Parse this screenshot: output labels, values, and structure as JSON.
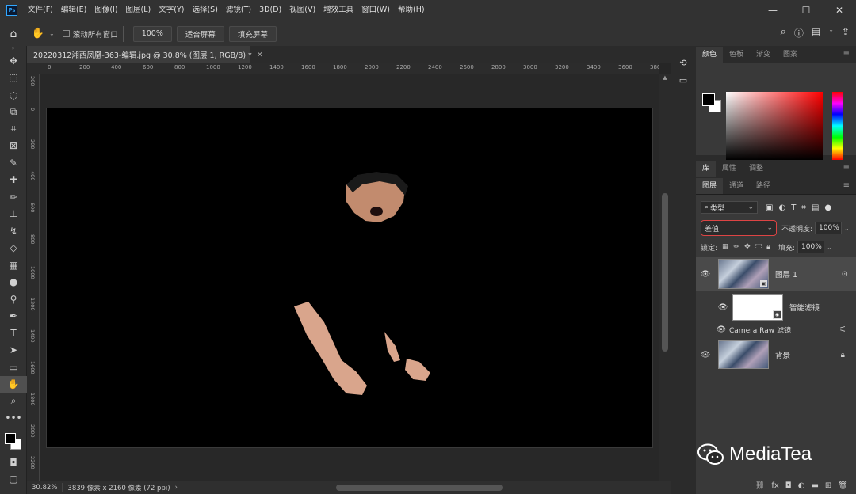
{
  "menubar": {
    "items": [
      "文件(F)",
      "编辑(E)",
      "图像(I)",
      "图层(L)",
      "文字(Y)",
      "选择(S)",
      "滤镜(T)",
      "3D(D)",
      "视图(V)",
      "增效工具",
      "窗口(W)",
      "帮助(H)"
    ]
  },
  "options": {
    "scroll_all_label": "滚动所有窗口",
    "zoom_btn": "100%",
    "fit_screen": "适合屏幕",
    "fill_screen": "填充屏幕"
  },
  "document": {
    "tab_title": "20220312湘西凤凰-363-编辑.jpg @ 30.8% (图层 1, RGB/8) *",
    "ruler_h": [
      "0",
      "200",
      "400",
      "600",
      "800",
      "1000",
      "1200",
      "1400",
      "1600",
      "1800",
      "2000",
      "2200",
      "2400",
      "2600",
      "2800",
      "3000",
      "3200",
      "3400",
      "3600",
      "380"
    ],
    "ruler_v": [
      "2 0 0",
      "0",
      "2 0 0",
      "4 0 0",
      "6 0 0",
      "8 0 0",
      "1 0 0 0",
      "1 2 0 0",
      "1 4 0 0",
      "1 6 0 0",
      "1 8 0 0",
      "2 0 0 0",
      "2 2 0 0"
    ]
  },
  "status": {
    "zoom": "30.82%",
    "info": "3839 像素 x 2160 像素 (72 ppi)"
  },
  "color_panel": {
    "tabs": [
      "颜色",
      "色板",
      "渐变",
      "图案"
    ]
  },
  "library_panel": {
    "tabs": [
      "库",
      "属性",
      "调整"
    ]
  },
  "layers_panel": {
    "tabs": [
      "图层",
      "通道",
      "路径"
    ],
    "filter_kind": "类型",
    "blend_mode": "差值",
    "opacity_label": "不透明度:",
    "opacity_value": "100%",
    "lock_label": "锁定:",
    "fill_label": "填充:",
    "fill_value": "100%",
    "layers": [
      {
        "name": "图层 1"
      },
      {
        "name": "智能滤镜"
      },
      {
        "name": "Camera Raw 滤镜"
      },
      {
        "name": "背景"
      }
    ]
  },
  "watermark": {
    "text": "MediaTea"
  }
}
